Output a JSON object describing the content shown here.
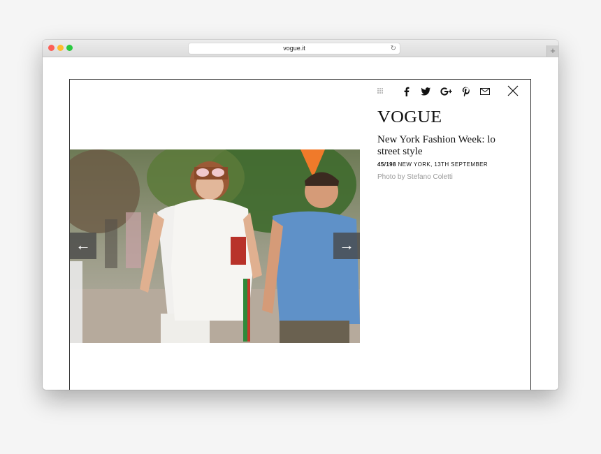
{
  "browser": {
    "url": "vogue.it",
    "reload_icon": "reload-icon",
    "new_tab_label": "+"
  },
  "gallery": {
    "prev_label": "←",
    "next_label": "→",
    "photo_description": "street style photograph"
  },
  "share": {
    "icons": [
      "grid-icon",
      "facebook-icon",
      "twitter-icon",
      "google-plus-icon",
      "pinterest-icon",
      "email-icon"
    ],
    "close_icon": "close-icon"
  },
  "article": {
    "logo": "VOGUE",
    "title": "New York Fashion Week: lo street style",
    "counter": "45/198",
    "location_date": "NEW YORK, 13TH SEPTEMBER",
    "credit": "Photo by Stefano Coletti"
  },
  "colors": {
    "close_red": "#fc5f57",
    "minimize_yellow": "#fdbc2e",
    "zoom_green": "#2ac940"
  }
}
